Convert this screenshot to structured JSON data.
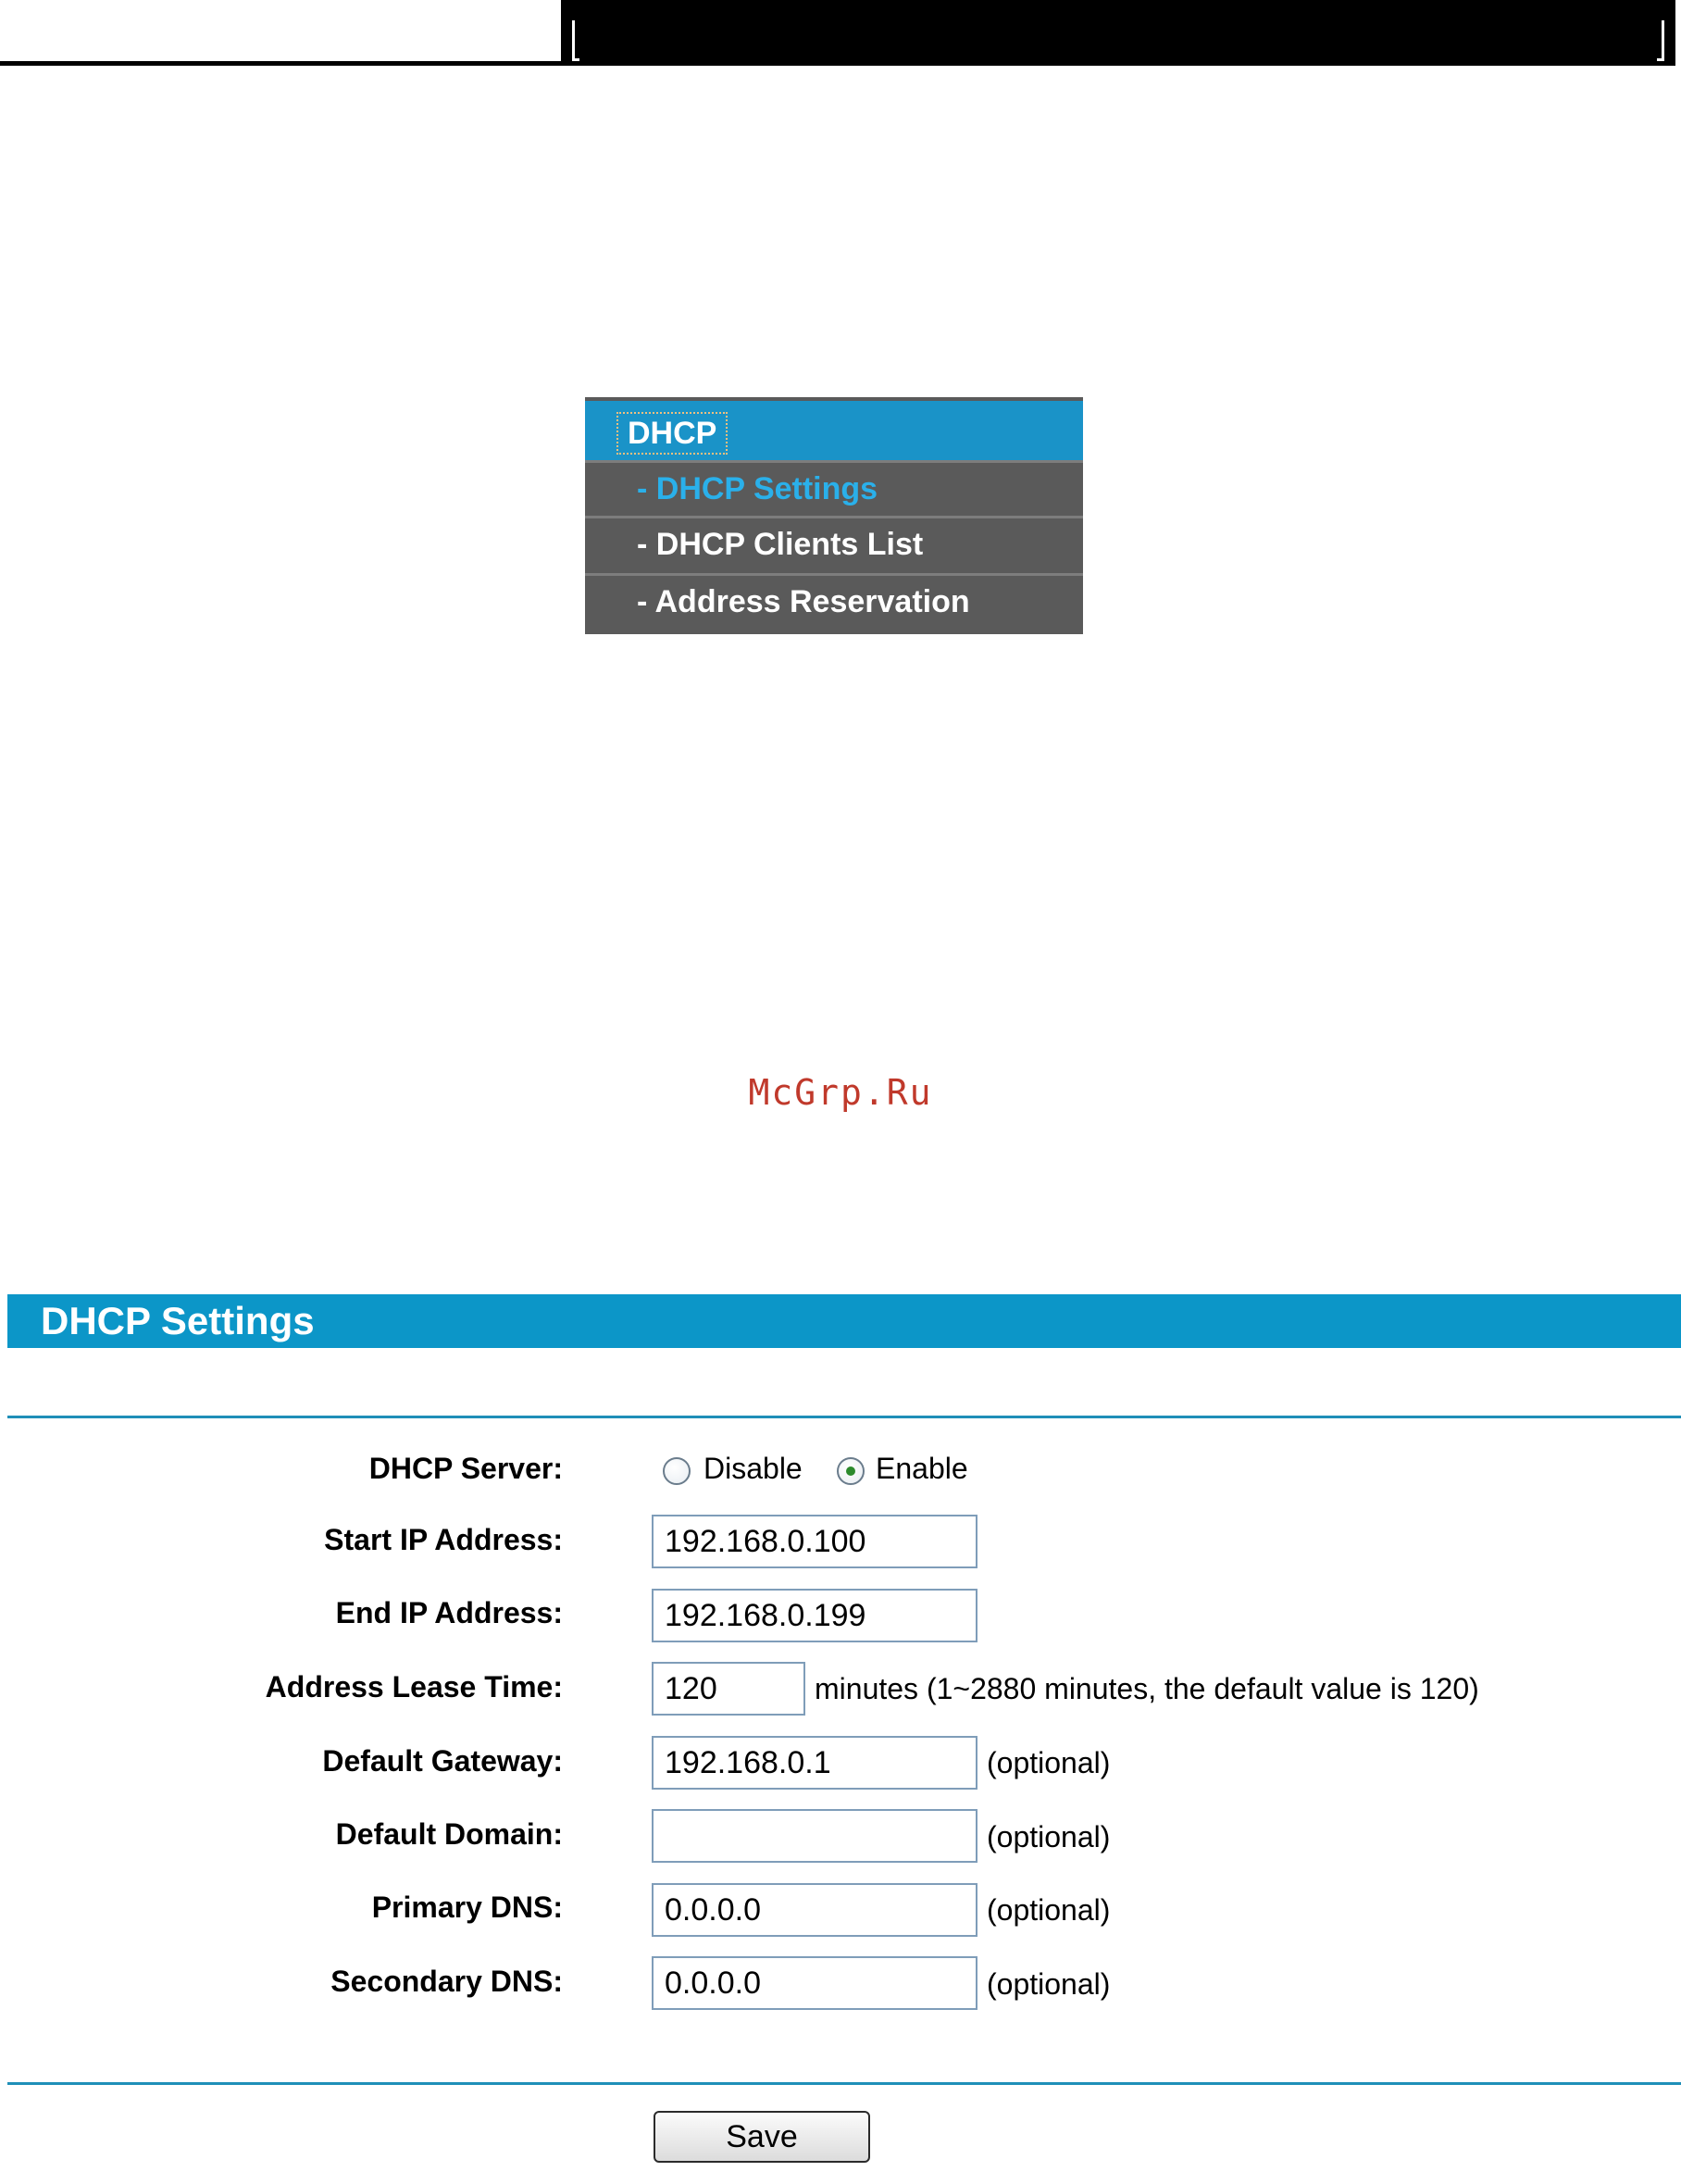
{
  "menu": {
    "header": "DHCP",
    "items": [
      {
        "label": "- DHCP Settings"
      },
      {
        "label": "- DHCP Clients List"
      },
      {
        "label": "- Address Reservation"
      }
    ]
  },
  "watermark": "McGrp.Ru",
  "panel": {
    "title": "DHCP Settings",
    "dhcp_server": {
      "label": "DHCP Server:",
      "options": [
        "Disable",
        "Enable"
      ],
      "selected": "Enable"
    },
    "fields": {
      "start_ip": {
        "label": "Start IP Address:",
        "value": "192.168.0.100"
      },
      "end_ip": {
        "label": "End IP Address:",
        "value": "192.168.0.199"
      },
      "lease_time": {
        "label": "Address Lease Time:",
        "value": "120",
        "hint": "minutes (1~2880 minutes, the default value is 120)"
      },
      "default_gateway": {
        "label": "Default Gateway:",
        "value": "192.168.0.1",
        "hint": "(optional)"
      },
      "default_domain": {
        "label": "Default Domain:",
        "value": "",
        "hint": "(optional)"
      },
      "primary_dns": {
        "label": "Primary DNS:",
        "value": "0.0.0.0",
        "hint": "(optional)"
      },
      "secondary_dns": {
        "label": "Secondary DNS:",
        "value": "0.0.0.0",
        "hint": "(optional)"
      }
    },
    "save_label": "Save"
  },
  "colors": {
    "accent": "#0c96c8",
    "menu_bg": "#5a5a5a",
    "menu_active": "#2ab0ea"
  }
}
